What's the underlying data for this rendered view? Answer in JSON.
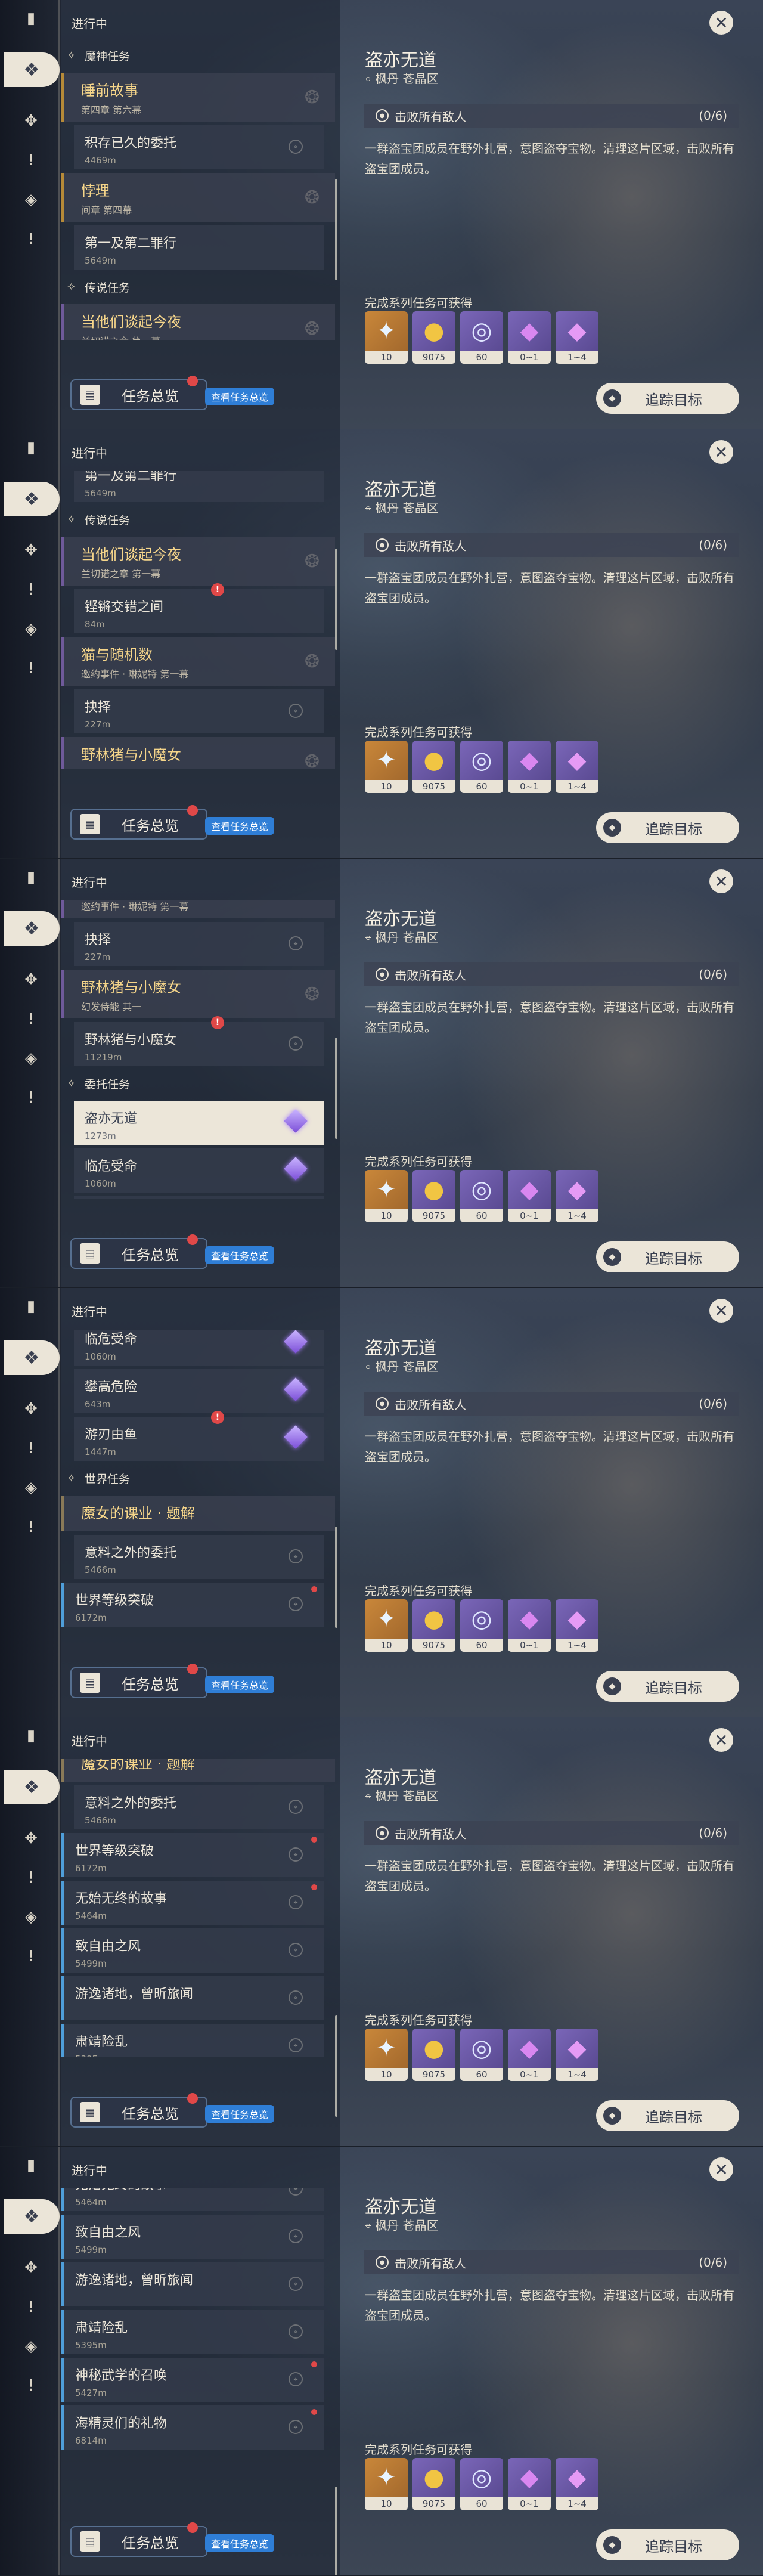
{
  "list_title": "进行中",
  "overview": {
    "label": "任务总览",
    "tip": "查看任务总览"
  },
  "detail": {
    "title": "盗亦无道",
    "location": "枫丹 苍晶区",
    "objective": "击败所有敌人",
    "progress": "(0/6)",
    "description": "一群盗宝团成员在野外扎营，意图盗夺宝物。清理这片区域，击败所有盗宝团成员。",
    "reward_title": "完成系列任务可获得",
    "track_label": "追踪目标",
    "rewards": [
      {
        "icon": "adventure-exp",
        "count": "10",
        "style": "gold",
        "glyph": "✦",
        "color": "#e8f4ff"
      },
      {
        "icon": "mora",
        "count": "9075",
        "style": "purple",
        "glyph": "●",
        "color": "#f1c543"
      },
      {
        "icon": "companionship-exp",
        "count": "60",
        "style": "purple",
        "glyph": "◎",
        "color": "#dfe6ff"
      },
      {
        "icon": "crystal-chunk",
        "count": "0~1",
        "style": "purple",
        "glyph": "◆",
        "color": "#d987f0"
      },
      {
        "icon": "crystal-cluster",
        "count": "1~4",
        "style": "purple",
        "glyph": "◆",
        "color": "#e59af5"
      }
    ]
  },
  "categories": {
    "archon": "魔神任务",
    "story": "传说任务",
    "commission": "委托任务",
    "world": "世界任务"
  },
  "quests": {
    "q1": {
      "name": "睡前故事",
      "sub": "第四章 第六幕"
    },
    "q1s": {
      "name": "积存已久的委托",
      "dist": "4469m"
    },
    "q2": {
      "name": "悖理",
      "sub": "间章 第四幕"
    },
    "q2s": {
      "name": "第一及第二罪行",
      "dist": "5649m"
    },
    "q3": {
      "name": "当他们谈起今夜",
      "sub": "兰切诺之章 第一幕"
    },
    "q3s": {
      "name": "铿锵交错之间",
      "dist": "84m"
    },
    "q4": {
      "name": "猫与随机数",
      "sub": "邀约事件 · 琳妮特 第一幕"
    },
    "q4s": {
      "name": "抉择",
      "dist": "227m"
    },
    "q5": {
      "name": "野林猪与小魔女",
      "sub": "幻发侍能 其一"
    },
    "q5s": {
      "name": "野林猪与小魔女",
      "dist": "11219m"
    },
    "c1": {
      "name": "盗亦无道",
      "dist": "1273m"
    },
    "c2": {
      "name": "临危受命",
      "dist": "1060m"
    },
    "c3": {
      "name": "攀高危险",
      "dist": "643m"
    },
    "c4": {
      "name": "游刃由鱼",
      "dist": "1447m"
    },
    "w0": {
      "name": "魔女的课业 · 题解"
    },
    "w1": {
      "name": "意料之外的委托",
      "dist": "5466m"
    },
    "w2": {
      "name": "世界等级突破",
      "dist": "6172m"
    },
    "w3": {
      "name": "无始无终的故事",
      "dist": "5464m"
    },
    "w4": {
      "name": "致自由之风",
      "dist": "5499m"
    },
    "w5": {
      "name": "游逸诸地，曾昕旅闻",
      "dist": ""
    },
    "w6": {
      "name": "肃靖险乱",
      "dist": "5395m"
    },
    "w7": {
      "name": "神秘武学的召唤",
      "dist": "5427m"
    },
    "w8": {
      "name": "海精灵们的礼物",
      "dist": "6814m"
    }
  }
}
